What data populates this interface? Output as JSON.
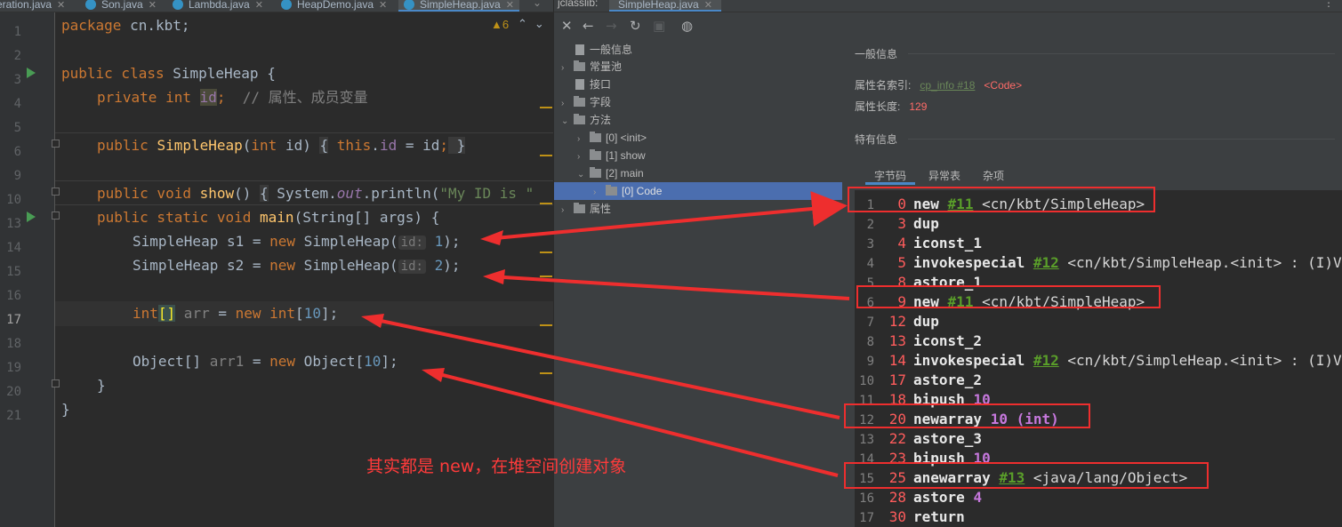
{
  "editor": {
    "tabs": [
      {
        "label": "eration.java",
        "active": false
      },
      {
        "label": "Son.java",
        "active": false
      },
      {
        "label": "Lambda.java",
        "active": false
      },
      {
        "label": "HeapDemo.java",
        "active": false
      },
      {
        "label": "SimpleHeap.java",
        "active": true
      }
    ],
    "warning_count": "6",
    "line_numbers": [
      "1",
      "2",
      "3",
      "4",
      "5",
      "6",
      "9",
      "10",
      "13",
      "14",
      "15",
      "16",
      "17",
      "18",
      "19",
      "20",
      "21"
    ],
    "current_line": "17",
    "code": {
      "l1_kw": "package",
      "l1_rest": " cn.kbt;",
      "l3_kw": "public class",
      "l3_rest": " SimpleHeap {",
      "l4_kw1": "private",
      "l4_kw2": " int ",
      "l4_id": "id",
      "l4_semi": ";",
      "l4_comment": "  // 属性、成员变量",
      "l6_kw": "public ",
      "l6_fn": "SimpleHeap",
      "l6_p1": "(",
      "l6_kw2": "int",
      "l6_p2": " id) ",
      "l6_ob": "{",
      "l6_this": " this",
      "l6_dot": ".",
      "l6_fld": "id",
      "l6_p3": " = id",
      "l6_semi": ";",
      "l6_cb": " }",
      "l10_kw": "public void ",
      "l10_fn": "show",
      "l10_p1": "() ",
      "l10_ob": "{",
      "l10_p2": " System.",
      "l10_out": "out",
      "l10_p3": ".println(",
      "l10_str": "\"My ID is \"",
      "l13_kw": "public static void ",
      "l13_fn": "main",
      "l13_rest": "(String[] args) {",
      "l14_a": "SimpleHeap ",
      "l14_var": "s1",
      "l14_b": " = ",
      "l14_kw": "new",
      "l14_c": " SimpleHeap(",
      "l14_hint": "id:",
      "l14_num": " 1",
      "l14_d": ");",
      "l15_a": "SimpleHeap ",
      "l15_var": "s2",
      "l15_b": " = ",
      "l15_kw": "new",
      "l15_c": " SimpleHeap(",
      "l15_hint": "id:",
      "l15_num": " 2",
      "l15_d": ");",
      "l17_kw": "int",
      "l17_br": "[]",
      "l17_var": " arr",
      "l17_b": " = ",
      "l17_kw2": "new int",
      "l17_c": "[",
      "l17_num": "10",
      "l17_d": "];",
      "l19_a": "Object[] ",
      "l19_var": "arr1",
      "l19_b": " = ",
      "l19_kw": "new",
      "l19_c": " Object[",
      "l19_num": "10",
      "l19_d": "];",
      "l20": "}",
      "l21": "}"
    }
  },
  "jclasslib": {
    "title": "jclasslib:",
    "tab_label": "SimpleHeap.java",
    "tree": [
      {
        "label": "一般信息",
        "type": "doc",
        "arrow": ""
      },
      {
        "label": "常量池",
        "type": "folder",
        "arrow": "›"
      },
      {
        "label": "接口",
        "type": "doc",
        "arrow": ""
      },
      {
        "label": "字段",
        "type": "folder",
        "arrow": "›"
      },
      {
        "label": "方法",
        "type": "folder",
        "arrow": "⌄"
      },
      {
        "label": "[0] <init>",
        "type": "folder",
        "arrow": "›"
      },
      {
        "label": "[1] show",
        "type": "folder",
        "arrow": "›"
      },
      {
        "label": "[2] main",
        "type": "folder",
        "arrow": "⌄"
      },
      {
        "label": "[0] Code",
        "type": "folder",
        "arrow": "›",
        "selected": true
      },
      {
        "label": "属性",
        "type": "folder",
        "arrow": "›"
      }
    ],
    "general_title": "一般信息",
    "attr_name_label": "属性名索引:",
    "attr_name_link": "cp_info #18",
    "attr_name_tag": "<Code>",
    "attr_len_label": "属性长度:",
    "attr_len_value": "129",
    "specific_title": "特有信息",
    "subtabs": [
      "字节码",
      "异常表",
      "杂项"
    ],
    "bytecode": [
      {
        "idx": "1",
        "off": "0",
        "op": "new",
        "ref": "#11",
        "arg": " <cn/kbt/SimpleHeap>"
      },
      {
        "idx": "2",
        "off": "3",
        "op": "dup"
      },
      {
        "idx": "3",
        "off": "4",
        "op": "iconst_1"
      },
      {
        "idx": "4",
        "off": "5",
        "op": "invokespecial",
        "ref": "#12",
        "arg": " <cn/kbt/SimpleHeap.<init> : (I)V>"
      },
      {
        "idx": "5",
        "off": "8",
        "op": "astore_1"
      },
      {
        "idx": "6",
        "off": "9",
        "op": "new",
        "ref": "#11",
        "arg": " <cn/kbt/SimpleHeap>"
      },
      {
        "idx": "7",
        "off": "12",
        "op": "dup"
      },
      {
        "idx": "8",
        "off": "13",
        "op": "iconst_2"
      },
      {
        "idx": "9",
        "off": "14",
        "op": "invokespecial",
        "ref": "#12",
        "arg": " <cn/kbt/SimpleHeap.<init> : (I)V>"
      },
      {
        "idx": "10",
        "off": "17",
        "op": "astore_2"
      },
      {
        "idx": "11",
        "off": "18",
        "op": "bipush",
        "int": "10"
      },
      {
        "idx": "12",
        "off": "20",
        "op": "newarray",
        "int": "10 (int)"
      },
      {
        "idx": "13",
        "off": "22",
        "op": "astore_3"
      },
      {
        "idx": "14",
        "off": "23",
        "op": "bipush",
        "int": "10"
      },
      {
        "idx": "15",
        "off": "25",
        "op": "anewarray",
        "ref": "#13",
        "arg": " <java/lang/Object>"
      },
      {
        "idx": "16",
        "off": "28",
        "op": "astore",
        "int": "4"
      },
      {
        "idx": "17",
        "off": "30",
        "op": "return"
      }
    ]
  },
  "annotation": {
    "text": "其实都是 new，在堆空间创建对象",
    "color": "#ee2e2e"
  }
}
